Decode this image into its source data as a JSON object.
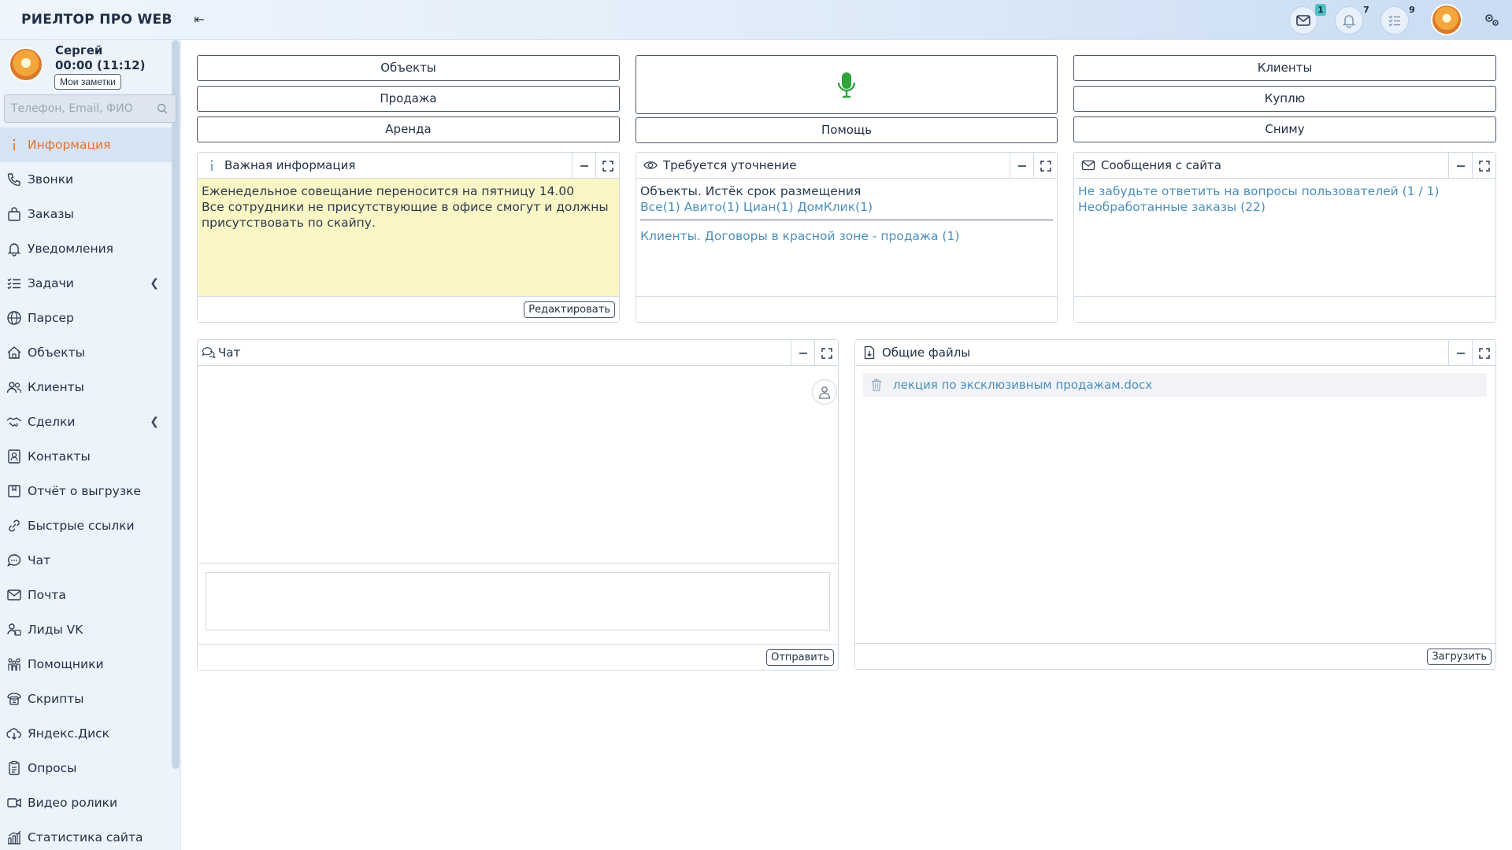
{
  "app": {
    "brand": "РИЕЛТОР ПРО WEB"
  },
  "topbar": {
    "mail_badge": "1",
    "notif_badge": "7",
    "tasks_badge": "9",
    "icons": [
      "mail-icon",
      "bell-icon",
      "task-list-icon",
      "avatar",
      "settings-icon"
    ]
  },
  "user": {
    "name": "Сергей",
    "time": "00:00 (11:12)",
    "notes_label": "Мои заметки"
  },
  "search": {
    "placeholder": "Телефон, Email, ФИО"
  },
  "sidebar": {
    "items": [
      {
        "label": "Информация",
        "icon": "info-icon",
        "active": true
      },
      {
        "label": "Звонки",
        "icon": "phone-icon"
      },
      {
        "label": "Заказы",
        "icon": "bag-icon"
      },
      {
        "label": "Уведомления",
        "icon": "bell-icon"
      },
      {
        "label": "Задачи",
        "icon": "task-list-icon",
        "expandable": true
      },
      {
        "label": "Парсер",
        "icon": "globe-icon"
      },
      {
        "label": "Объекты",
        "icon": "house-icon"
      },
      {
        "label": "Клиенты",
        "icon": "users-icon"
      },
      {
        "label": "Сделки",
        "icon": "handshake-icon",
        "expandable": true
      },
      {
        "label": "Контакты",
        "icon": "contact-card-icon"
      },
      {
        "label": "Отчёт о выгрузке",
        "icon": "report-icon"
      },
      {
        "label": "Быстрые ссылки",
        "icon": "link-icon"
      },
      {
        "label": "Чат",
        "icon": "chat-icon"
      },
      {
        "label": "Почта",
        "icon": "mail-icon"
      },
      {
        "label": "Лиды VK",
        "icon": "lead-icon"
      },
      {
        "label": "Помощники",
        "icon": "helpers-icon"
      },
      {
        "label": "Скрипты",
        "icon": "script-phone-icon"
      },
      {
        "label": "Яндекс.Диск",
        "icon": "cloud-download-icon"
      },
      {
        "label": "Опросы",
        "icon": "clipboard-icon"
      },
      {
        "label": "Видео ролики",
        "icon": "video-icon"
      },
      {
        "label": "Статистика сайта",
        "icon": "stats-icon"
      }
    ]
  },
  "quick_buttons": {
    "objects": "Объекты",
    "sale": "Продажа",
    "rent": "Аренда",
    "help": "Помощь",
    "clients": "Клиенты",
    "buy": "Куплю",
    "lease": "Сниму"
  },
  "important_info": {
    "title": "Важная информация",
    "line1": "Еженедельное совещание переносится на пятницу 14.00",
    "line2": "Все сотрудники не присутствующие в офисе смогут и должны присутствовать по скайпу.",
    "edit_label": "Редактировать"
  },
  "clarification": {
    "title": "Требуется уточнение",
    "objects_expired": "Объекты. Истёк срок размещения",
    "links": [
      "Все(1)",
      "Авито(1)",
      "Циан(1)",
      "ДомКлик(1)"
    ],
    "clients_red_zone": "Клиенты. Договоры в красной зоне - продажа (1)"
  },
  "site_messages": {
    "title": "Сообщения с сайта",
    "item1": "Не забудьте ответить на вопросы пользователей (1 / 1)",
    "item2": "Необработанные заказы (22)"
  },
  "chat": {
    "title": "Чат",
    "send_label": "Отправить"
  },
  "files": {
    "title": "Общие файлы",
    "items": [
      "лекция по эксклюзивным продажам.docx"
    ],
    "upload_label": "Загрузить"
  },
  "colors": {
    "accent": "#e2742e",
    "link": "#4c8fbe",
    "info_bg": "#fbf6c6",
    "mic": "#2ea43a"
  }
}
